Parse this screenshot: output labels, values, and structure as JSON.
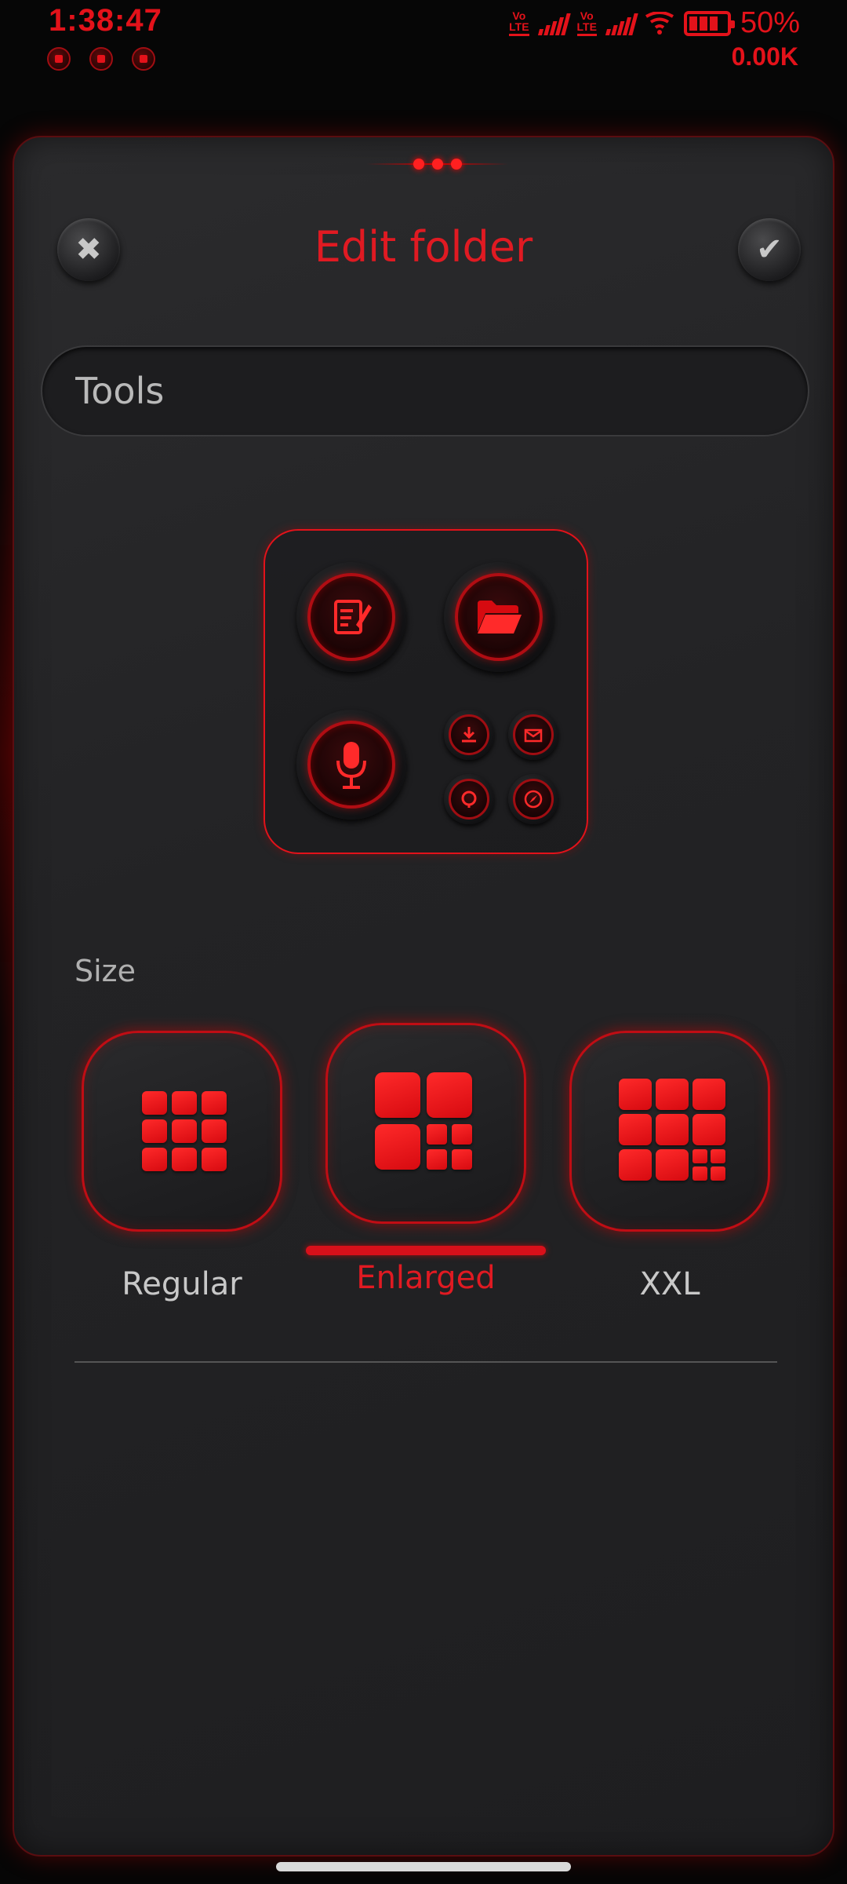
{
  "status_bar": {
    "time": "1:38:47",
    "volte_1": "Vo LTE",
    "volte_2": "Vo LTE",
    "battery_percent": "50%",
    "net_speed": "0.00K",
    "notification_icons": [
      "whatsapp-icon",
      "telegram-icon",
      "inbox-icon"
    ]
  },
  "dialog": {
    "title": "Edit folder",
    "folder_name": "Tools",
    "size_label": "Size",
    "size_options": [
      {
        "label": "Regular",
        "selected": false
      },
      {
        "label": "Enlarged",
        "selected": true
      },
      {
        "label": "XXL",
        "selected": false
      }
    ],
    "folder_apps": [
      "notes-icon",
      "files-folder-icon",
      "voice-recorder-icon",
      "downloads-icon",
      "email-icon",
      "theme-icon",
      "compass-icon"
    ]
  },
  "colors": {
    "accent": "#e3121a",
    "background": "#060606",
    "sheet": "#252527",
    "text": "#c8c8c8"
  }
}
